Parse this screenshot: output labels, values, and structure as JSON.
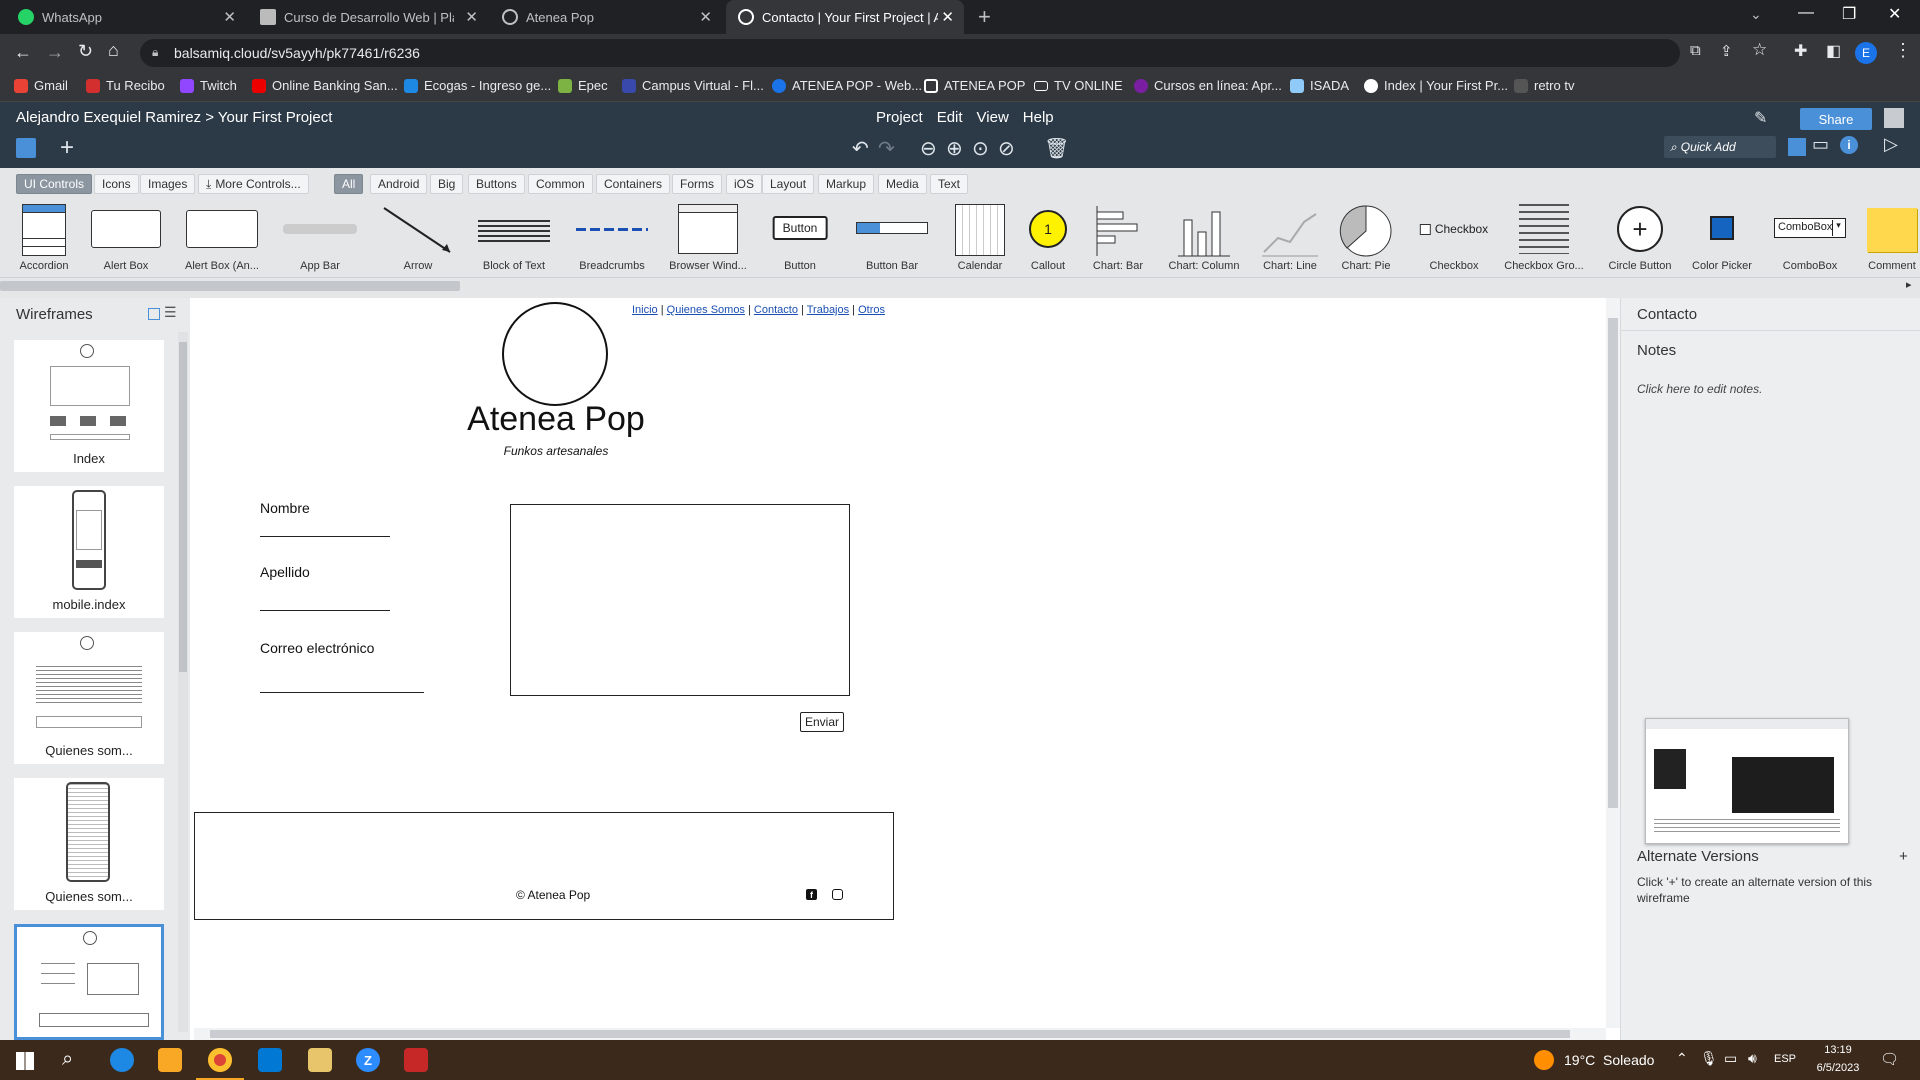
{
  "browser": {
    "tabs": [
      {
        "title": "WhatsApp"
      },
      {
        "title": "Curso de Desarrollo Web | Plataf"
      },
      {
        "title": "Atenea Pop"
      },
      {
        "title": "Contacto | Your First Project | Ale"
      }
    ],
    "url": "balsamiq.cloud/sv5ayyh/pk77461/r6236",
    "bookmarks": [
      "Gmail",
      "Tu Recibo",
      "Twitch",
      "Online Banking San...",
      "Ecogas - Ingreso ge...",
      "Epec",
      "Campus Virtual - Fl...",
      "ATENEA POP - Web...",
      "ATENEA POP",
      "TV ONLINE",
      "Cursos en línea: Apr...",
      "ISADA",
      "Index | Your First Pr...",
      "retro tv"
    ]
  },
  "app": {
    "breadcrumb": "Alejandro Exequiel Ramirez > Your First Project",
    "menu": [
      "Project",
      "Edit",
      "View",
      "Help"
    ],
    "quick_add_placeholder": "Quick Add",
    "share_label": "Share",
    "categories": [
      "UI Controls",
      "Icons",
      "Images",
      "More Controls...",
      "All",
      "Android",
      "Big",
      "Buttons",
      "Common",
      "Containers",
      "Forms",
      "iOS",
      "Layout",
      "Markup",
      "Media",
      "Text"
    ],
    "controls": [
      "Accordion",
      "Alert Box",
      "Alert Box (An...",
      "App Bar",
      "Arrow",
      "Block of Text",
      "Breadcrumbs",
      "Browser Wind...",
      "Button",
      "Button Bar",
      "Calendar",
      "Callout",
      "Chart: Bar",
      "Chart: Column",
      "Chart: Line",
      "Chart: Pie",
      "Checkbox",
      "Checkbox Gro...",
      "Circle Button",
      "Color Picker",
      "ComboBox",
      "Comment"
    ],
    "control_text": {
      "button": "Button",
      "checkbox": "Checkbox",
      "combobox": "ComboBox",
      "callout": "1"
    }
  },
  "wireframes": {
    "title": "Wireframes",
    "items": [
      "Index",
      "mobile.index",
      "Quienes som...",
      "Quienes som...",
      ""
    ]
  },
  "wireframe": {
    "nav": [
      "Inicio",
      "Quienes Somos",
      "Contacto",
      "Trabajos",
      "Otros"
    ],
    "brand": "Atenea Pop",
    "tagline": "Funkos artesanales",
    "fields": [
      "Nombre",
      "Apellido",
      "Correo electrónico"
    ],
    "submit": "Enviar",
    "footer": "© Atenea Pop"
  },
  "right": {
    "page_title": "Contacto",
    "notes_label": "Notes",
    "notes_hint": "Click here to edit notes.",
    "alt_title": "Alternate Versions",
    "alt_hint": "Click '+' to create an alternate version of this wireframe"
  },
  "taskbar": {
    "weather": "19°C  Soleado",
    "lang": "ESP",
    "time": "13:19",
    "date": "6/5/2023"
  }
}
